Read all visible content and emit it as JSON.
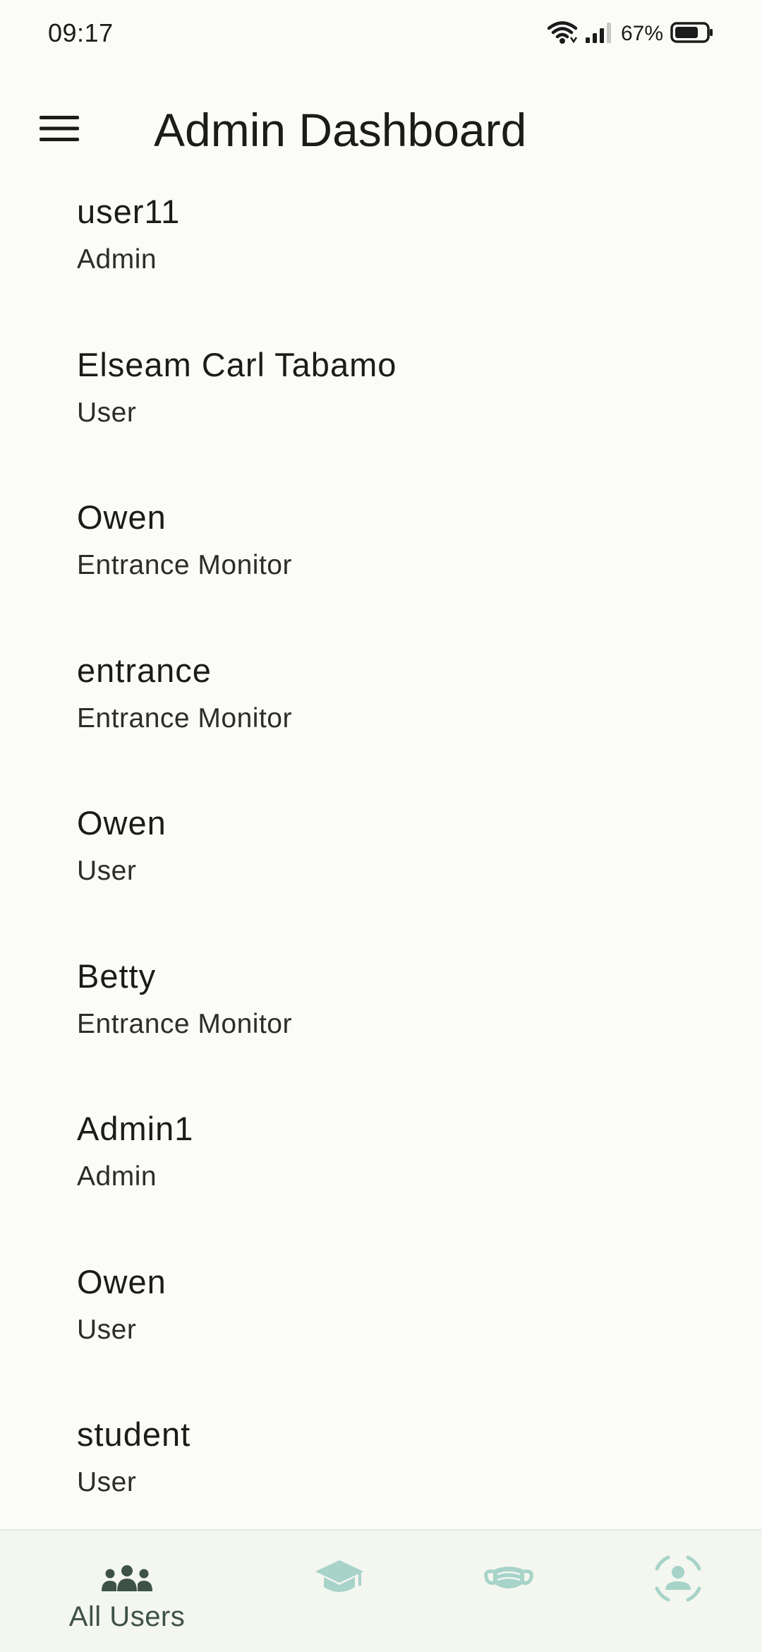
{
  "status_bar": {
    "time": "09:17",
    "battery_percent": "67%",
    "icons": [
      "wifi-icon",
      "signal-icon",
      "battery-icon"
    ]
  },
  "app_bar": {
    "menu_icon": "menu-icon",
    "title": "Admin Dashboard"
  },
  "users": [
    {
      "name": "user11",
      "role": "Admin"
    },
    {
      "name": "Elseam Carl Tabamo",
      "role": "User"
    },
    {
      "name": "Owen",
      "role": "Entrance Monitor"
    },
    {
      "name": "entrance",
      "role": "Entrance Monitor"
    },
    {
      "name": "Owen",
      "role": "User"
    },
    {
      "name": "Betty",
      "role": "Entrance Monitor"
    },
    {
      "name": "Admin1",
      "role": "Admin"
    },
    {
      "name": "Owen",
      "role": "User"
    },
    {
      "name": "student",
      "role": "User"
    }
  ],
  "bottom_nav": {
    "items": [
      {
        "icon": "group-icon",
        "label": "All Users",
        "active": true
      },
      {
        "icon": "graduation-cap-icon",
        "label": "",
        "active": false
      },
      {
        "icon": "face-mask-icon",
        "label": "",
        "active": false
      },
      {
        "icon": "face-scan-icon",
        "label": "",
        "active": false
      }
    ]
  },
  "colors": {
    "background": "#fbfcf7",
    "nav_background": "#f4f6f0",
    "nav_active": "#3e5248",
    "nav_inactive": "#a7d3c8",
    "text_primary": "#1b1c18"
  }
}
